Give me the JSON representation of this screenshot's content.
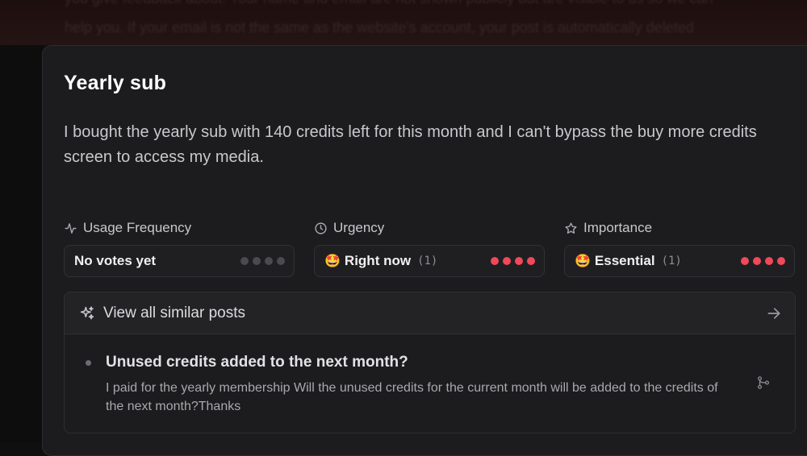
{
  "post": {
    "title": "Yearly sub",
    "body": "I bought the yearly sub with 140 credits left for this month and I can't bypass the buy more credits screen to access my media."
  },
  "background": {
    "line1": "you give feedback about. Your name and email are not shown publicly but are visible to us so we can",
    "line2": "help you. If your email is not the same as the website's account, your post is automatically deleted"
  },
  "metrics": [
    {
      "label": "Usage Frequency",
      "icon": "activity-icon",
      "value": "No votes yet",
      "emoji": "",
      "count": "",
      "level": 0,
      "max": 4
    },
    {
      "label": "Urgency",
      "icon": "clock-icon",
      "value": "Right now",
      "emoji": "🤩",
      "count": "(1)",
      "level": 4,
      "max": 4
    },
    {
      "label": "Importance",
      "icon": "star-icon",
      "value": "Essential",
      "emoji": "🤩",
      "count": "(1)",
      "level": 4,
      "max": 4
    }
  ],
  "similar": {
    "header": "View all similar posts",
    "icon": "sparkles-icon",
    "posts": [
      {
        "title": "Unused credits added to the next month?",
        "excerpt": "I paid for the yearly membership Will the unused credits for the current month will be added to the credits of the next month?Thanks"
      }
    ]
  },
  "colors": {
    "accent_dot": "#f0495a",
    "inactive_dot": "#4a4a4f",
    "modal_bg": "#1c1c1e"
  }
}
